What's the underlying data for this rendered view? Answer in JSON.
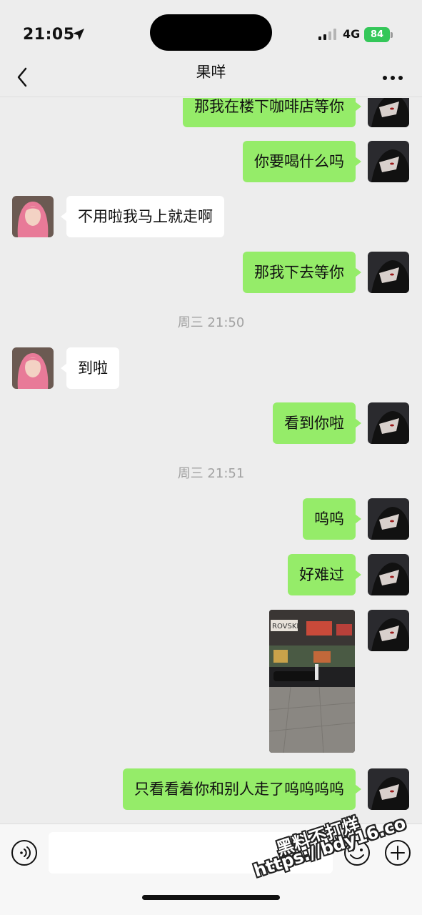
{
  "status_bar": {
    "time": "21:05",
    "network": "4G",
    "battery": "84"
  },
  "nav": {
    "title": "果咩"
  },
  "messages": [
    {
      "sender": "me",
      "text": "那我在楼下咖啡店等你"
    },
    {
      "sender": "me",
      "text": "你要喝什么吗"
    },
    {
      "sender": "other",
      "text": "不用啦我马上就走啊"
    },
    {
      "sender": "me",
      "text": "那我下去等你"
    },
    {
      "type": "timestamp",
      "text": "周三 21:50"
    },
    {
      "sender": "other",
      "text": "到啦"
    },
    {
      "sender": "me",
      "text": "看到你啦"
    },
    {
      "type": "timestamp",
      "text": "周三 21:51"
    },
    {
      "sender": "me",
      "text": "呜呜"
    },
    {
      "sender": "me",
      "text": "好难过"
    },
    {
      "sender": "me",
      "type": "image",
      "image_text": "ROVSKI"
    },
    {
      "sender": "me",
      "text": "只看看着你和别人走了呜呜呜呜"
    }
  ],
  "input": {
    "placeholder": ""
  },
  "watermark": {
    "line1": "黑料不打烊",
    "line2": "https://bdy16.co"
  },
  "colors": {
    "my_bubble": "#95ec69",
    "other_bubble": "#ffffff",
    "background": "#ededed",
    "battery": "#34c759"
  },
  "icons": [
    "location-arrow-icon",
    "signal-icon",
    "back-chevron-icon",
    "more-dots-icon",
    "voice-icon",
    "emoji-icon",
    "plus-icon"
  ]
}
